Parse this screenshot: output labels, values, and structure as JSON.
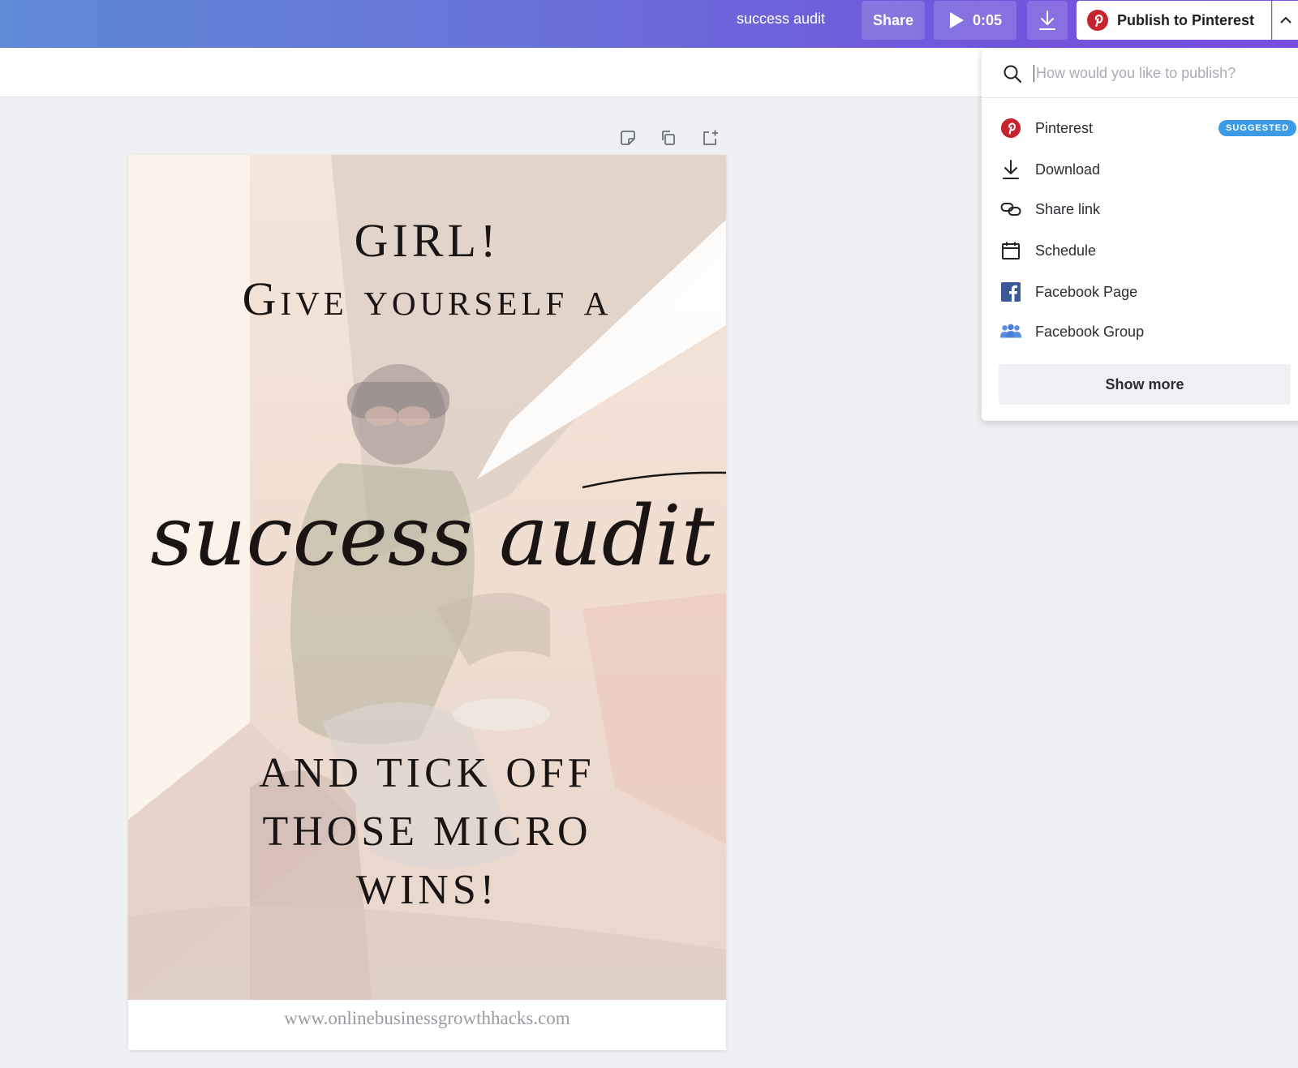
{
  "topbar": {
    "doc_title": "success audit",
    "share_label": "Share",
    "play_duration": "0:05",
    "publish_label": "Publish to Pinterest"
  },
  "design": {
    "line1": "GIRL!",
    "line2": "Give yourself a",
    "script": "success audit",
    "line3": "AND TICK OFF",
    "line4": "THOSE MICRO",
    "line5": "WINS!",
    "footer": "www.onlinebusinessgrowthhacks.com"
  },
  "publish_menu": {
    "search_placeholder": "How would you like to publish?",
    "items": [
      {
        "label": "Pinterest",
        "icon": "pinterest-icon",
        "badge": "SUGGESTED"
      },
      {
        "label": "Download",
        "icon": "download-icon"
      },
      {
        "label": "Share link",
        "icon": "link-icon"
      },
      {
        "label": "Schedule",
        "icon": "calendar-icon"
      },
      {
        "label": "Facebook Page",
        "icon": "facebook-icon"
      },
      {
        "label": "Facebook Group",
        "icon": "group-icon"
      }
    ],
    "show_more": "Show more"
  },
  "colors": {
    "topbar_start": "#5e8ad6",
    "topbar_end": "#7a4ee0",
    "pinterest_red": "#c8232c",
    "facebook_blue": "#3b5998",
    "badge_blue": "#3b9be5"
  }
}
